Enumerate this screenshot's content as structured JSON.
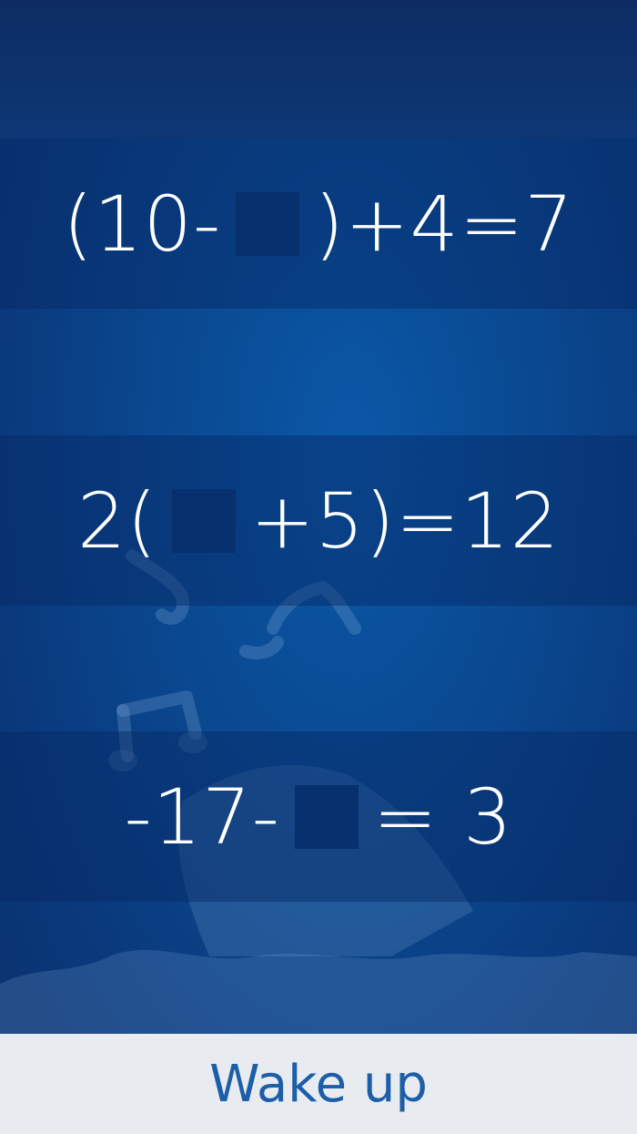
{
  "equations": [
    {
      "before": "(10-",
      "after": ")+4=7",
      "blank_label": ""
    },
    {
      "before": "2(",
      "after": "+5)=12",
      "blank_label": ""
    },
    {
      "before": "-17-",
      "after": "= 3",
      "blank_label": ""
    }
  ],
  "footer": {
    "wake_label": "Wake up"
  },
  "colors": {
    "background": "#0a4a92",
    "band": "#0a3572",
    "blank": "#06306e",
    "footer_bg": "#e8ecf1",
    "button_text": "#1d5ea8"
  }
}
